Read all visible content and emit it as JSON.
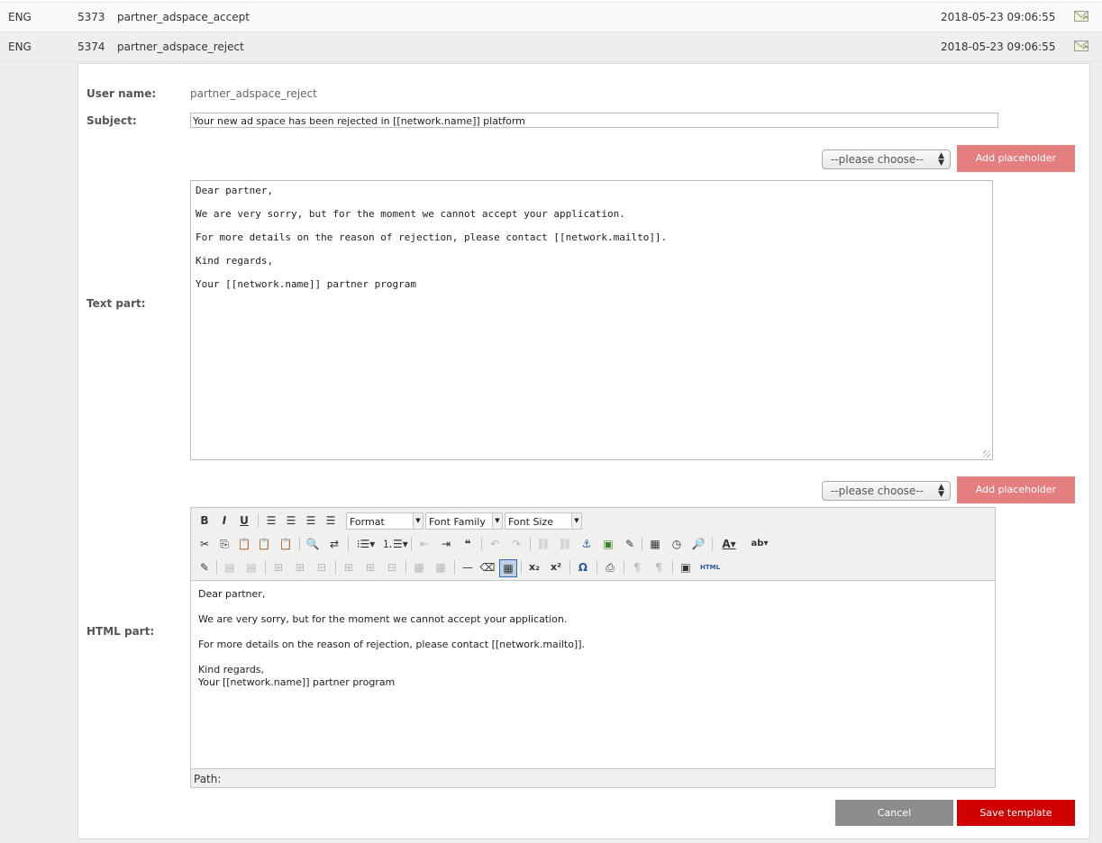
{
  "rows": [
    {
      "lang": "ENG",
      "id": "5373",
      "name": "partner_adspace_accept",
      "date": "2018-05-23 09:06:55"
    },
    {
      "lang": "ENG",
      "id": "5374",
      "name": "partner_adspace_reject",
      "date": "2018-05-23 09:06:55"
    }
  ],
  "form": {
    "user_name_label": "User name:",
    "user_name_value": "partner_adspace_reject",
    "subject_label": "Subject:",
    "subject_value": "Your new ad space has been rejected in [[network.name]] platform",
    "text_part_label": "Text part:",
    "html_part_label": "HTML part:",
    "placeholder_select": "--please choose--",
    "add_placeholder": "Add placeholder",
    "text_lines": [
      "Dear partner,",
      "We are very sorry, but for the moment we cannot accept your application.",
      "For more details on the reason of rejection, please contact [[network.mailto]].",
      "Kind regards,",
      "Your [[network.name]] partner program"
    ],
    "html_p1": "Dear partner,",
    "html_p2": "We are very sorry, but for the moment we cannot accept your application.",
    "html_p3": "For more details on the reason of rejection, please contact [[network.mailto]].",
    "html_p4a": "Kind regards,",
    "html_p4b": "Your [[network.name]] partner program",
    "cancel": "Cancel",
    "save": "Save template"
  },
  "editor": {
    "format": "Format",
    "font_family": "Font Family",
    "font_size": "Font Size",
    "path_label": "Path:",
    "html_btn": "HTML"
  },
  "icons": {
    "row_action": "envelope-icon"
  },
  "colors": {
    "add_placeholder_bg": "#e57f7f",
    "save_bg": "#d10000",
    "cancel_bg": "#8d8d8d"
  }
}
